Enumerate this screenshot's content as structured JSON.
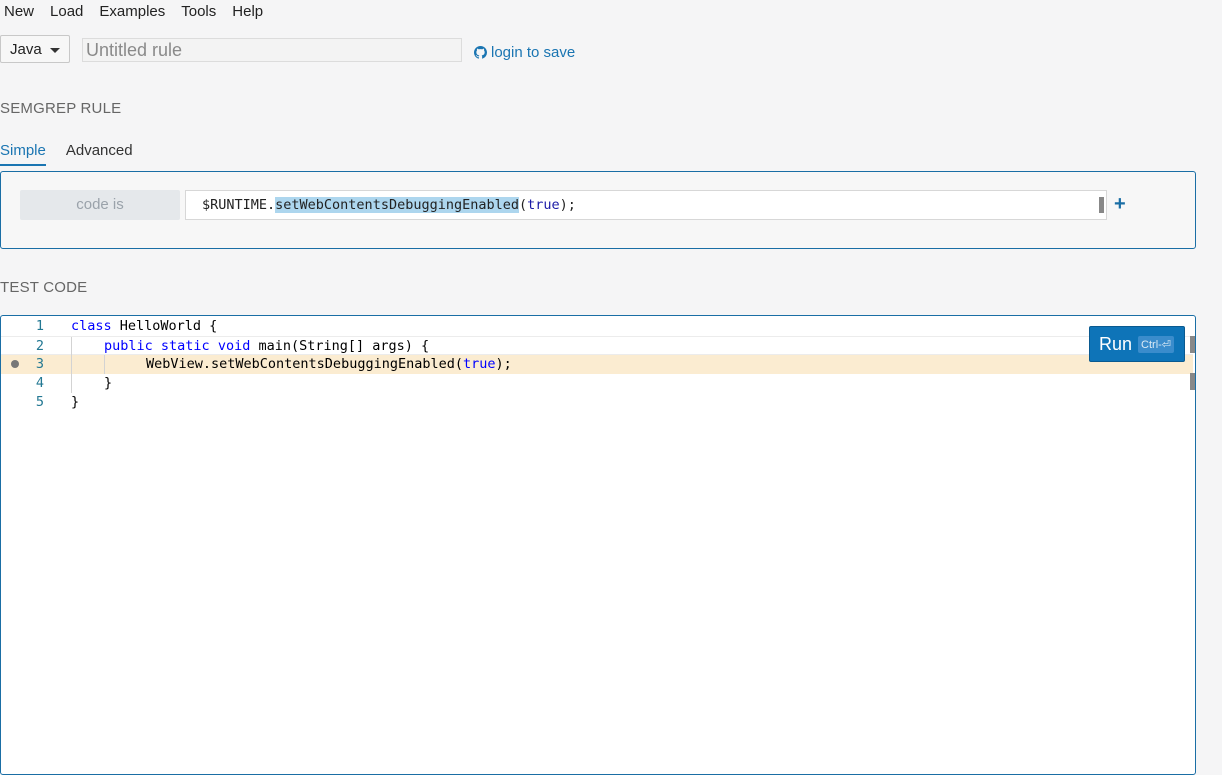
{
  "menu": {
    "items": [
      {
        "label": "New"
      },
      {
        "label": "Load"
      },
      {
        "label": "Examples"
      },
      {
        "label": "Tools"
      },
      {
        "label": "Help"
      }
    ]
  },
  "toolbar": {
    "language": "Java",
    "title_placeholder": "Untitled rule",
    "login_label": "login to save"
  },
  "rule_section": {
    "heading": "SEMGREP RULE",
    "tabs": [
      {
        "label": "Simple",
        "active": true
      },
      {
        "label": "Advanced",
        "active": false
      }
    ],
    "operator": "code is",
    "pattern": {
      "prefix": "$RUNTIME.",
      "highlight": "setWebContentsDebuggingEnabled",
      "open": "(",
      "keyword": "true",
      "close": ");"
    },
    "add_label": "+"
  },
  "test_section": {
    "heading": "TEST CODE",
    "run_label": "Run",
    "run_shortcut": "Ctrl-⏎",
    "lines": [
      {
        "num": "1",
        "text": "class HelloWorld {"
      },
      {
        "num": "2",
        "text": "public static void main(String[] args) {"
      },
      {
        "num": "3",
        "text": "WebView.setWebContentsDebuggingEnabled(true);"
      },
      {
        "num": "4",
        "text": "}"
      },
      {
        "num": "5",
        "text": "}"
      }
    ],
    "colors": {
      "match_highlight": "#fbecd1",
      "accent": "#1a75b2"
    }
  }
}
